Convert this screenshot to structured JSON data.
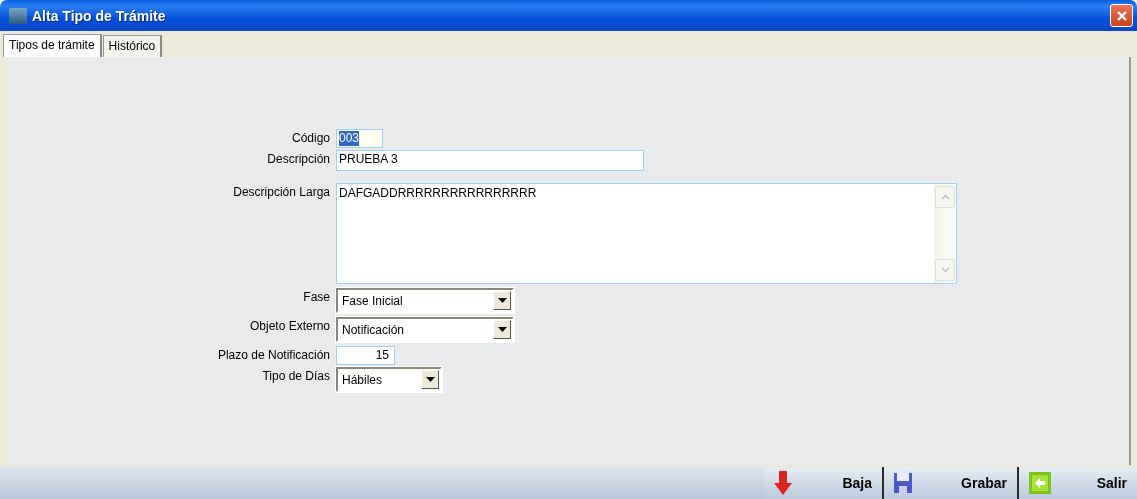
{
  "window": {
    "title": "Alta Tipo de Trámite"
  },
  "tabs": [
    {
      "label": "Tipos de trámite",
      "selected": true
    },
    {
      "label": "Histórico",
      "selected": false
    }
  ],
  "fields": [
    {
      "kind": "text",
      "label": "Código",
      "value": "003",
      "highlighted": true
    },
    {
      "kind": "text",
      "label": "Descripción",
      "value": "PRUEBA 3",
      "highlighted": false
    },
    {
      "kind": "textarea",
      "label": "Descripción Larga",
      "value": "DAFGADDRRRRRRRRRRRRRRRR"
    },
    {
      "kind": "select",
      "label": "Fase",
      "value": "Fase Inicial"
    },
    {
      "kind": "select",
      "label": "Objeto Externo",
      "value": "Notificación"
    },
    {
      "kind": "text",
      "label": "Plazo de Notificación",
      "value": "15",
      "highlighted": false
    },
    {
      "kind": "select",
      "label": "Tipo de Días",
      "value": "Hábiles"
    }
  ],
  "buttons": [
    {
      "kind": "delete",
      "label": "Baja"
    },
    {
      "kind": "save",
      "label": "Grabar"
    },
    {
      "kind": "exit",
      "label": "Salir"
    }
  ]
}
